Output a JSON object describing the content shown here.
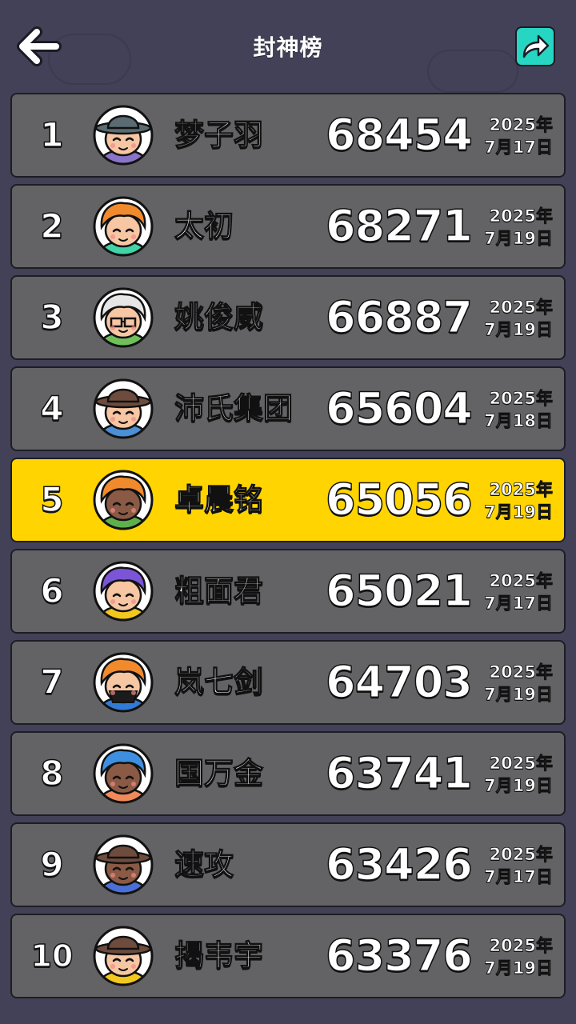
{
  "header": {
    "title": "封神榜",
    "back_icon": "back-arrow-icon",
    "share_icon": "share-arrow-icon"
  },
  "colors": {
    "background": "#434157",
    "row": "#636366",
    "highlight": "#ffd400",
    "share_button": "#27d5c3"
  },
  "leaderboard": [
    {
      "rank": "1",
      "name": "梦子羽",
      "score": "68454",
      "year": "2025年",
      "day": "7月17日",
      "hair": "#5b6b72",
      "shirt": "#8a74c9",
      "hat": true,
      "hat_color": "#5b6b72",
      "highlight": false
    },
    {
      "rank": "2",
      "name": "太初",
      "score": "68271",
      "year": "2025年",
      "day": "7月19日",
      "hair": "#f08a2c",
      "shirt": "#42d3a6",
      "hat": false,
      "highlight": false
    },
    {
      "rank": "3",
      "name": "姚俊威",
      "score": "66887",
      "year": "2025年",
      "day": "7月19日",
      "hair": "#e6e6e6",
      "shirt": "#6fbf5a",
      "hat": false,
      "glasses": true,
      "highlight": false
    },
    {
      "rank": "4",
      "name": "沛氏集团",
      "score": "65604",
      "year": "2025年",
      "day": "7月18日",
      "hair": "#6d4c3e",
      "shirt": "#4b8fd6",
      "hat": true,
      "hat_color": "#6d4c3e",
      "highlight": false
    },
    {
      "rank": "5",
      "name": "卓晨铭",
      "score": "65056",
      "year": "2025年",
      "day": "7月19日",
      "hair": "#f08a2c",
      "shirt": "#5fb04d",
      "hat": false,
      "dark_face": true,
      "highlight": true
    },
    {
      "rank": "6",
      "name": "粗面君",
      "score": "65021",
      "year": "2025年",
      "day": "7月17日",
      "hair": "#7b55d6",
      "shirt": "#f2c81d",
      "hat": false,
      "highlight": false
    },
    {
      "rank": "7",
      "name": "岚七剑",
      "score": "64703",
      "year": "2025年",
      "day": "7月19日",
      "hair": "#f08a2c",
      "shirt": "#2f7bd6",
      "hat": false,
      "mask": true,
      "highlight": false
    },
    {
      "rank": "8",
      "name": "国万金",
      "score": "63741",
      "year": "2025年",
      "day": "7月19日",
      "hair": "#3f8fe0",
      "shirt": "#f08a5a",
      "hat": false,
      "dark_face": true,
      "highlight": false
    },
    {
      "rank": "9",
      "name": "速攻",
      "score": "63426",
      "year": "2025年",
      "day": "7月17日",
      "hair": "#6d4c3e",
      "shirt": "#4b6fd6",
      "hat": true,
      "hat_color": "#6d4c3e",
      "dark_face": true,
      "highlight": false
    },
    {
      "rank": "10",
      "name": "揭韦宇",
      "score": "63376",
      "year": "2025年",
      "day": "7月19日",
      "hair": "#6d4c3e",
      "shirt": "#f2c81d",
      "hat": true,
      "hat_color": "#6d4c3e",
      "highlight": false
    }
  ]
}
